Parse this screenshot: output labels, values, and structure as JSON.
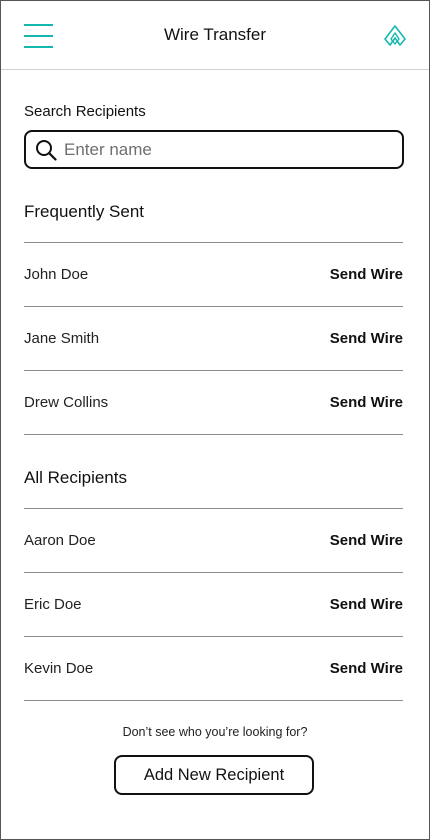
{
  "header": {
    "title": "Wire Transfer",
    "menu_icon": "hamburger-menu-icon",
    "logo_icon": "drop-logo-icon",
    "accent_color": "#14b8b0"
  },
  "search": {
    "label": "Search Recipients",
    "placeholder": "Enter name",
    "value": "",
    "icon": "search-icon"
  },
  "frequent": {
    "title": "Frequently Sent",
    "recipients": [
      {
        "name": "John Doe",
        "action": "Send Wire"
      },
      {
        "name": "Jane Smith",
        "action": "Send Wire"
      },
      {
        "name": "Drew Collins",
        "action": "Send Wire"
      }
    ]
  },
  "all": {
    "title": "All Recipients",
    "recipients": [
      {
        "name": "Aaron Doe",
        "action": "Send Wire"
      },
      {
        "name": "Eric Doe",
        "action": "Send Wire"
      },
      {
        "name": "Kevin Doe",
        "action": "Send Wire"
      }
    ]
  },
  "footer": {
    "hint": "Don’t see who you’re looking for?",
    "add_button": "Add New Recipient"
  }
}
